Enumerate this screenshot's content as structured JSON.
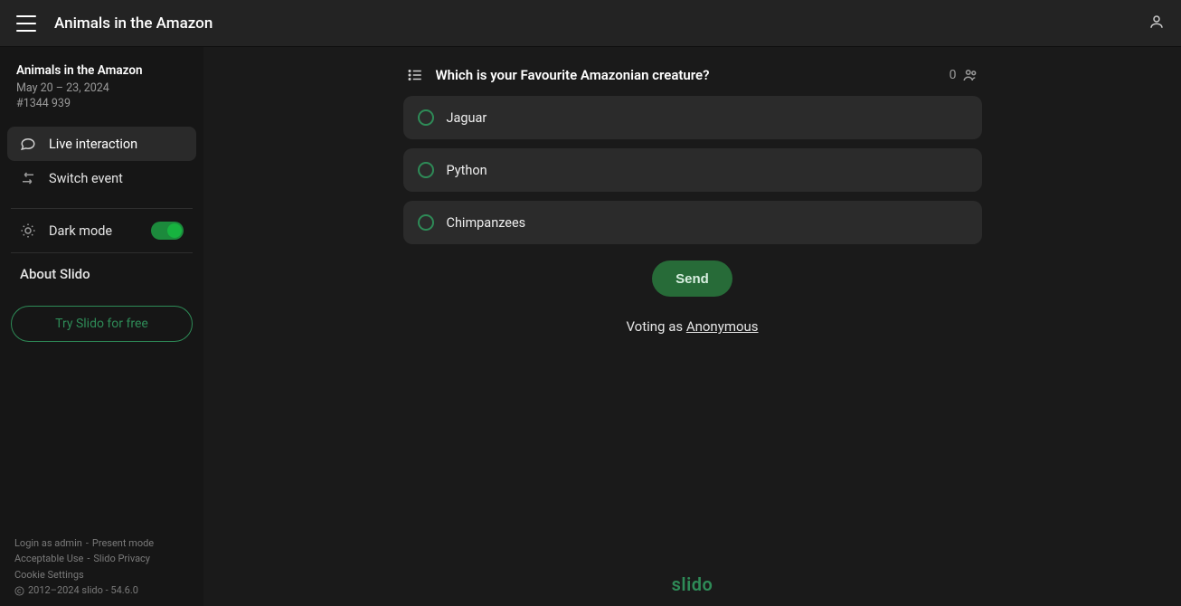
{
  "topbar": {
    "title": "Animals in the Amazon"
  },
  "sidebar": {
    "event_title": "Animals in the Amazon",
    "date_range": "May 20 – 23, 2024",
    "event_code": "#1344 939",
    "items": [
      {
        "label": "Live interaction"
      },
      {
        "label": "Switch event"
      }
    ],
    "dark_mode_label": "Dark mode",
    "about_label": "About Slido",
    "cta_label": "Try Slido for free",
    "footer": {
      "login_admin": "Login as admin",
      "present_mode": "Present mode",
      "acceptable_use": "Acceptable Use",
      "slido_privacy": "Slido Privacy",
      "cookie_settings": "Cookie Settings",
      "copyright": "2012–2024 slido - 54.6.0"
    }
  },
  "poll": {
    "question": "Which is your Favourite Amazonian creature?",
    "participants": "0",
    "options": [
      {
        "label": "Jaguar"
      },
      {
        "label": "Python"
      },
      {
        "label": "Chimpanzees"
      }
    ],
    "send_label": "Send",
    "voting_as_prefix": "Voting as ",
    "voting_as_name": "Anonymous"
  },
  "brand": "slido"
}
